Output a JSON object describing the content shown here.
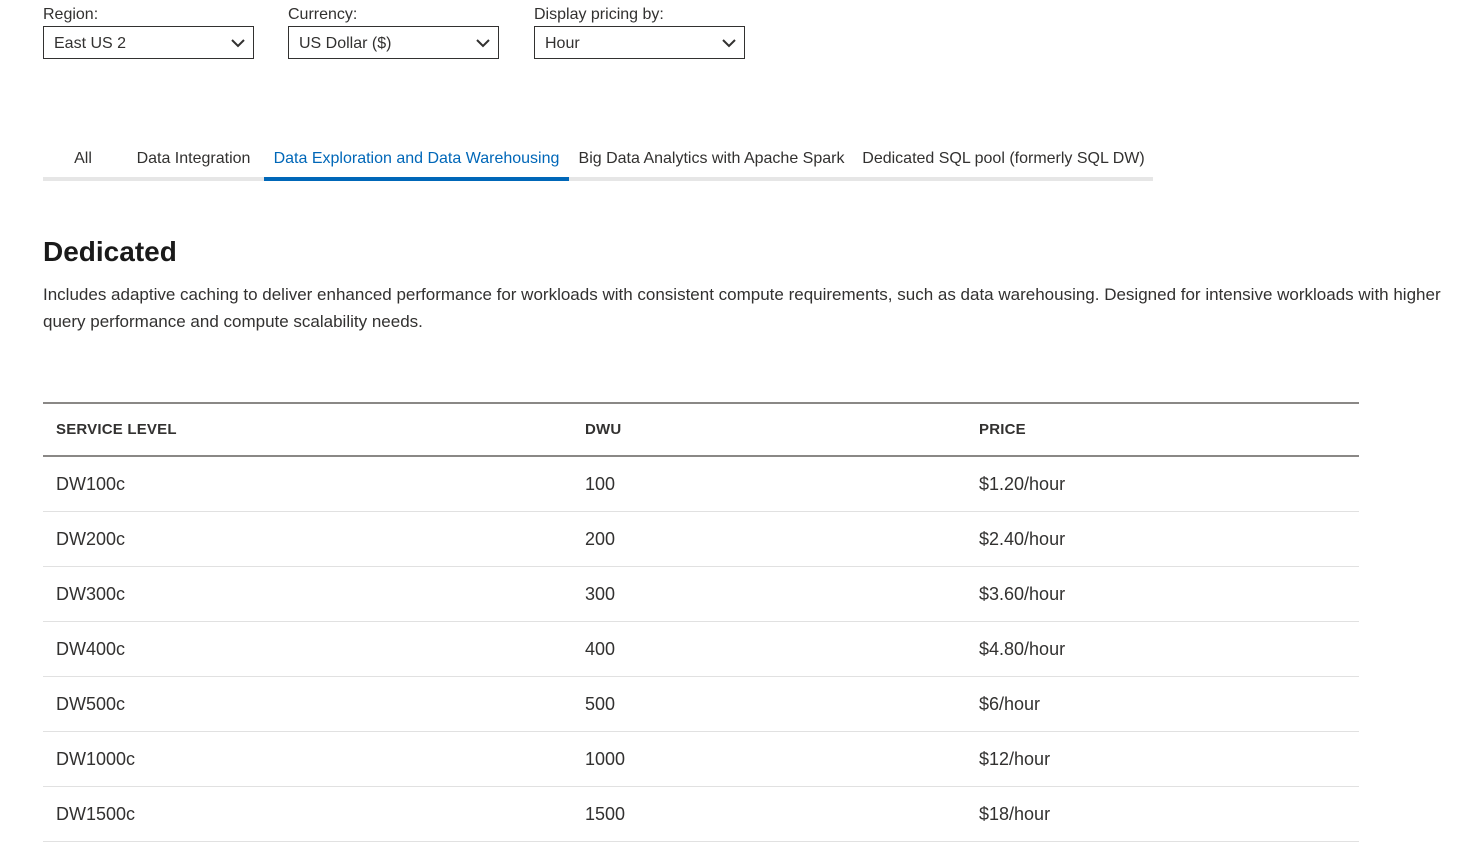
{
  "filters": {
    "region": {
      "label": "Region:",
      "value": "East US 2"
    },
    "currency": {
      "label": "Currency:",
      "value": "US Dollar ($)"
    },
    "display": {
      "label": "Display pricing by:",
      "value": "Hour"
    },
    "chevron_icon": "chevron-down-icon"
  },
  "tabs": [
    {
      "label": "All",
      "active": false
    },
    {
      "label": "Data Integration",
      "active": false
    },
    {
      "label": "Data Exploration and Data Warehousing",
      "active": true
    },
    {
      "label": "Big Data Analytics with Apache Spark",
      "active": false
    },
    {
      "label": "Dedicated SQL pool (formerly SQL DW)",
      "active": false
    }
  ],
  "section": {
    "title": "Dedicated",
    "description": "Includes adaptive caching to deliver enhanced performance for workloads with consistent compute requirements, such as data warehousing. Designed for intensive workloads with higher query performance and compute scalability needs."
  },
  "table": {
    "headers": [
      "SERVICE LEVEL",
      "DWU",
      "PRICE"
    ],
    "rows": [
      [
        "DW100c",
        "100",
        "$1.20/hour"
      ],
      [
        "DW200c",
        "200",
        "$2.40/hour"
      ],
      [
        "DW300c",
        "300",
        "$3.60/hour"
      ],
      [
        "DW400c",
        "400",
        "$4.80/hour"
      ],
      [
        "DW500c",
        "500",
        "$6/hour"
      ],
      [
        "DW1000c",
        "1000",
        "$12/hour"
      ],
      [
        "DW1500c",
        "1500",
        "$18/hour"
      ]
    ]
  },
  "colors": {
    "accent": "#0067b8",
    "text": "#323130",
    "tab_underline": "#e6e6e6",
    "table_rule": "#8a8886"
  }
}
